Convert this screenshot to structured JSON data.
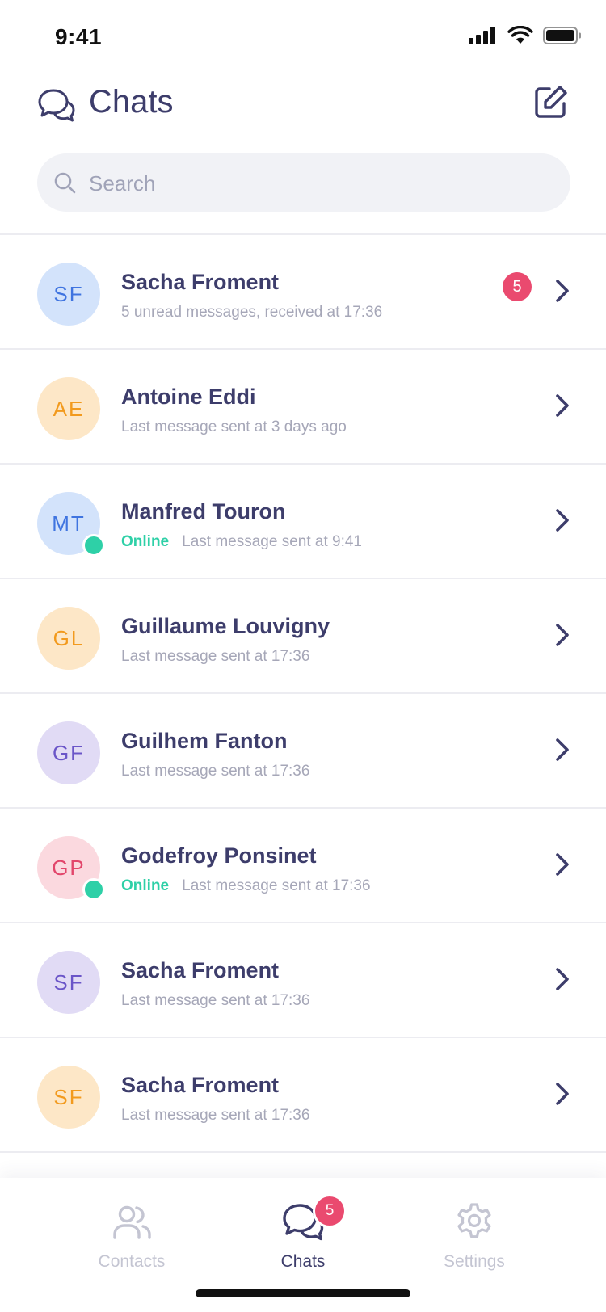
{
  "status_bar": {
    "time": "9:41"
  },
  "header": {
    "title": "Chats"
  },
  "search": {
    "placeholder": "Search"
  },
  "chats": [
    {
      "initials": "SF",
      "name": "Sacha Froment",
      "online": false,
      "online_label": "",
      "subtitle": "5 unread messages, received at 17:36",
      "unread": "5",
      "avatar_bg": "#d3e3fb",
      "avatar_fg": "#3f74e0"
    },
    {
      "initials": "AE",
      "name": "Antoine Eddi",
      "online": false,
      "online_label": "",
      "subtitle": "Last message sent at 3 days ago",
      "unread": "",
      "avatar_bg": "#fde7c7",
      "avatar_fg": "#f29a1d"
    },
    {
      "initials": "MT",
      "name": "Manfred Touron",
      "online": true,
      "online_label": "Online",
      "subtitle": "Last message sent at 9:41",
      "unread": "",
      "avatar_bg": "#d3e3fb",
      "avatar_fg": "#3f74e0"
    },
    {
      "initials": "GL",
      "name": "Guillaume Louvigny",
      "online": false,
      "online_label": "",
      "subtitle": "Last message sent at 17:36",
      "unread": "",
      "avatar_bg": "#fde7c7",
      "avatar_fg": "#f29a1d"
    },
    {
      "initials": "GF",
      "name": "Guilhem Fanton",
      "online": false,
      "online_label": "",
      "subtitle": "Last message sent at 17:36",
      "unread": "",
      "avatar_bg": "#e1dbf5",
      "avatar_fg": "#6a55c8"
    },
    {
      "initials": "GP",
      "name": "Godefroy Ponsinet",
      "online": true,
      "online_label": "Online",
      "subtitle": "Last message sent at 17:36",
      "unread": "",
      "avatar_bg": "#fbd9df",
      "avatar_fg": "#e2466b"
    },
    {
      "initials": "SF",
      "name": "Sacha Froment",
      "online": false,
      "online_label": "",
      "subtitle": "Last message sent at 17:36",
      "unread": "",
      "avatar_bg": "#e1dbf5",
      "avatar_fg": "#6a55c8"
    },
    {
      "initials": "SF",
      "name": "Sacha Froment",
      "online": false,
      "online_label": "",
      "subtitle": "Last message sent at 17:36",
      "unread": "",
      "avatar_bg": "#fde7c7",
      "avatar_fg": "#f29a1d"
    }
  ],
  "tabs": [
    {
      "label": "Contacts",
      "icon": "contacts-icon",
      "active": false,
      "badge": ""
    },
    {
      "label": "Chats",
      "icon": "chats-icon",
      "active": true,
      "badge": "5"
    },
    {
      "label": "Settings",
      "icon": "gear-icon",
      "active": false,
      "badge": ""
    }
  ],
  "colors": {
    "accent": "#3d3d6b",
    "online": "#2ed0a7",
    "badge": "#ea4a6f",
    "muted": "#a6a7b8",
    "inactive_tab": "#c4c5d2"
  }
}
